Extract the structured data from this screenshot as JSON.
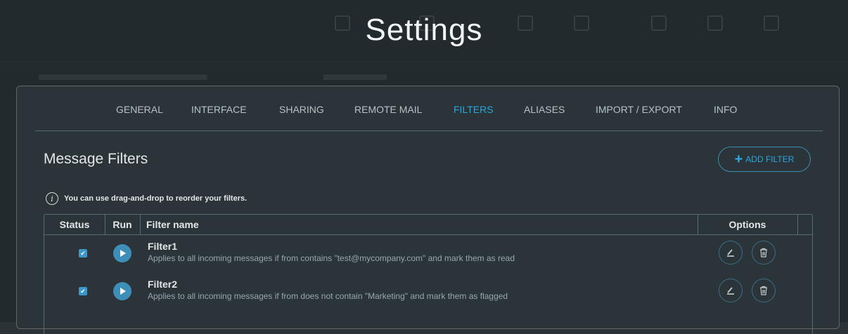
{
  "page_title": "Settings",
  "tabs": [
    {
      "label": "GENERAL",
      "active": false
    },
    {
      "label": "INTERFACE",
      "active": false
    },
    {
      "label": "SHARING",
      "active": false
    },
    {
      "label": "REMOTE MAIL",
      "active": false
    },
    {
      "label": "FILTERS",
      "active": true
    },
    {
      "label": "ALIASES",
      "active": false
    },
    {
      "label": "IMPORT / EXPORT",
      "active": false
    },
    {
      "label": "INFO",
      "active": false
    }
  ],
  "section": {
    "title": "Message Filters",
    "add_button_label": "ADD FILTER",
    "info_text": "You can use drag-and-drop to reorder your filters."
  },
  "table": {
    "headers": {
      "status": "Status",
      "run": "Run",
      "name": "Filter name",
      "options": "Options"
    },
    "rows": [
      {
        "checked": true,
        "name": "Filter1",
        "description": "Applies to all incoming messages if from contains \"test@mycompany.com\" and mark them as read"
      },
      {
        "checked": true,
        "name": "Filter2",
        "description": "Applies to all incoming messages if from does not contain \"Marketing\" and mark them as flagged"
      }
    ]
  },
  "icons": {
    "info": "info-icon",
    "add": "plus-icon",
    "run": "play-icon",
    "edit": "edit-icon",
    "delete": "trash-icon",
    "check": "check-icon"
  },
  "colors": {
    "background": "#2b3337",
    "accent": "#29a7df",
    "checkbox": "#3c96c7",
    "run_button": "#3d8fb9"
  }
}
